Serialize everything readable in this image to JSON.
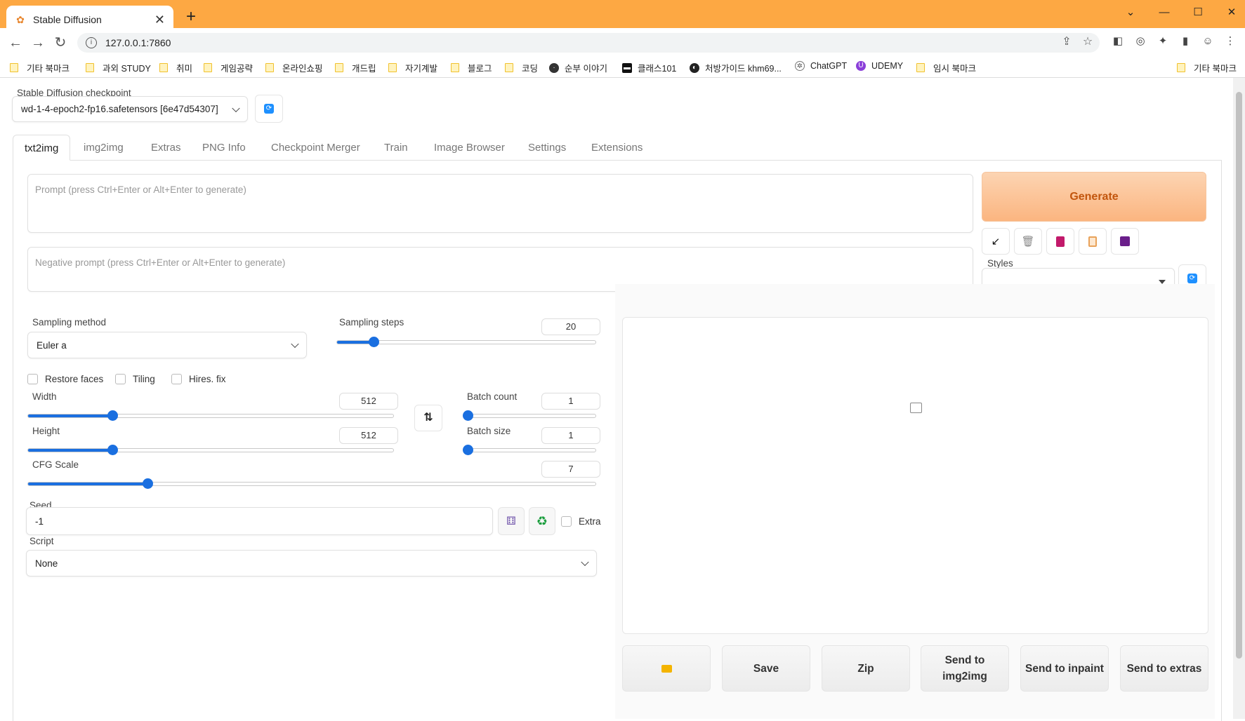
{
  "browser": {
    "tab_title": "Stable Diffusion",
    "url": "127.0.0.1:7860",
    "bookmarks": [
      {
        "label": "기타 북마크",
        "icon": "folder"
      },
      {
        "label": "과외 STUDY",
        "icon": "folder"
      },
      {
        "label": "취미",
        "icon": "folder"
      },
      {
        "label": "게임공략",
        "icon": "folder"
      },
      {
        "label": "온라인쇼핑",
        "icon": "folder"
      },
      {
        "label": "개드립",
        "icon": "folder"
      },
      {
        "label": "자기계발",
        "icon": "folder"
      },
      {
        "label": "블로그",
        "icon": "folder"
      },
      {
        "label": "코딩",
        "icon": "folder"
      },
      {
        "label": "순부 이야기",
        "icon": "site"
      },
      {
        "label": "클래스101",
        "icon": "site"
      },
      {
        "label": "처방가이드 khm69...",
        "icon": "site"
      },
      {
        "label": "ChatGPT",
        "icon": "site"
      },
      {
        "label": "UDEMY",
        "icon": "site"
      },
      {
        "label": "임시 북마크",
        "icon": "folder"
      }
    ],
    "other_bookmarks": "기타 북마크"
  },
  "checkpoint": {
    "label": "Stable Diffusion checkpoint",
    "value": "wd-1-4-epoch2-fp16.safetensors [6e47d54307]"
  },
  "tabs": [
    "txt2img",
    "img2img",
    "Extras",
    "PNG Info",
    "Checkpoint Merger",
    "Train",
    "Image Browser",
    "Settings",
    "Extensions"
  ],
  "prompt": {
    "placeholder": "Prompt (press Ctrl+Enter or Alt+Enter to generate)",
    "value": ""
  },
  "negative_prompt": {
    "placeholder": "Negative prompt (press Ctrl+Enter or Alt+Enter to generate)",
    "value": ""
  },
  "generate_label": "Generate",
  "styles_label": "Styles",
  "sampling": {
    "method_label": "Sampling method",
    "method_value": "Euler a",
    "steps_label": "Sampling steps",
    "steps_value": "20",
    "steps_fraction": 0.14
  },
  "options": {
    "restore_faces": "Restore faces",
    "tiling": "Tiling",
    "hires_fix": "Hires. fix"
  },
  "width": {
    "label": "Width",
    "value": "512",
    "fraction": 0.23
  },
  "height": {
    "label": "Height",
    "value": "512",
    "fraction": 0.23
  },
  "batch_count": {
    "label": "Batch count",
    "value": "1",
    "fraction": 0.0
  },
  "batch_size": {
    "label": "Batch size",
    "value": "1",
    "fraction": 0.0
  },
  "cfg": {
    "label": "CFG Scale",
    "value": "7",
    "fraction": 0.21
  },
  "seed": {
    "label": "Seed",
    "value": "-1",
    "extra_label": "Extra"
  },
  "script": {
    "label": "Script",
    "value": "None"
  },
  "output_buttons": {
    "save": "Save",
    "zip": "Zip",
    "send_img2img": "Send to\nimg2img",
    "send_inpaint": "Send to inpaint",
    "send_extras": "Send to extras"
  },
  "colors": {
    "titlebar": "#fda843",
    "generate_text": "#c2560e",
    "slider": "#1a6fe0",
    "refresh": "#1e90ff"
  }
}
